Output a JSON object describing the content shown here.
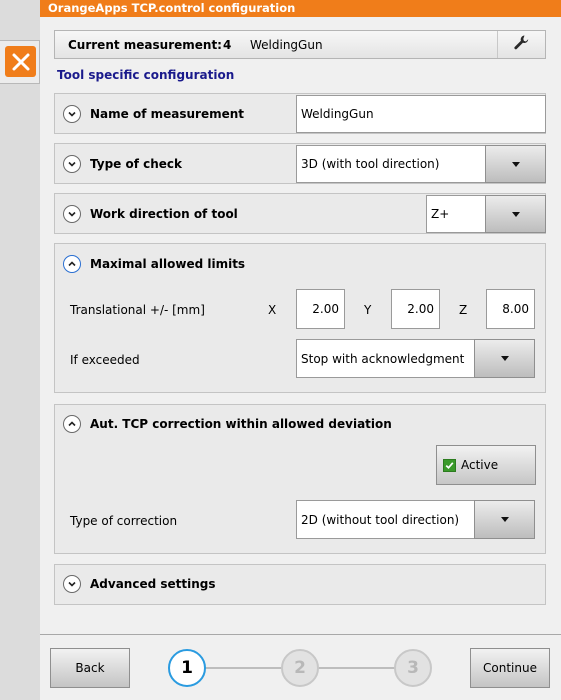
{
  "window": {
    "title": "OrangeApps TCP.control configuration"
  },
  "header": {
    "label": "Current measurement:",
    "number": "4",
    "name": "WeldingGun",
    "wrench_icon": "wrench-icon"
  },
  "section_title": "Tool specific configuration",
  "name_panel": {
    "label": "Name of measurement",
    "value": "WeldingGun"
  },
  "check_panel": {
    "label": "Type of check",
    "value": "3D (with tool direction)"
  },
  "direction_panel": {
    "label": "Work direction of tool",
    "value": "Z+"
  },
  "limits_panel": {
    "label": "Maximal allowed limits",
    "translational_label": "Translational +/- [mm]",
    "x_label": "X",
    "x_value": "2.00",
    "y_label": "Y",
    "y_value": "2.00",
    "z_label": "Z",
    "z_value": "8.00",
    "exceeded_label": "If exceeded",
    "exceeded_value": "Stop with acknowledgment"
  },
  "correction_panel": {
    "label": "Aut. TCP correction within allowed deviation",
    "active_label": "Active",
    "active_checked": true,
    "type_label": "Type of correction",
    "type_value": "2D (without tool direction)"
  },
  "advanced_panel": {
    "label": "Advanced settings"
  },
  "footer": {
    "back_label": "Back",
    "continue_label": "Continue",
    "steps": [
      "1",
      "2",
      "3"
    ],
    "current_step": 1
  },
  "colors": {
    "accent": "#f07d1a",
    "step_active": "#2a9be0",
    "title_blue": "#1a1a8c"
  }
}
